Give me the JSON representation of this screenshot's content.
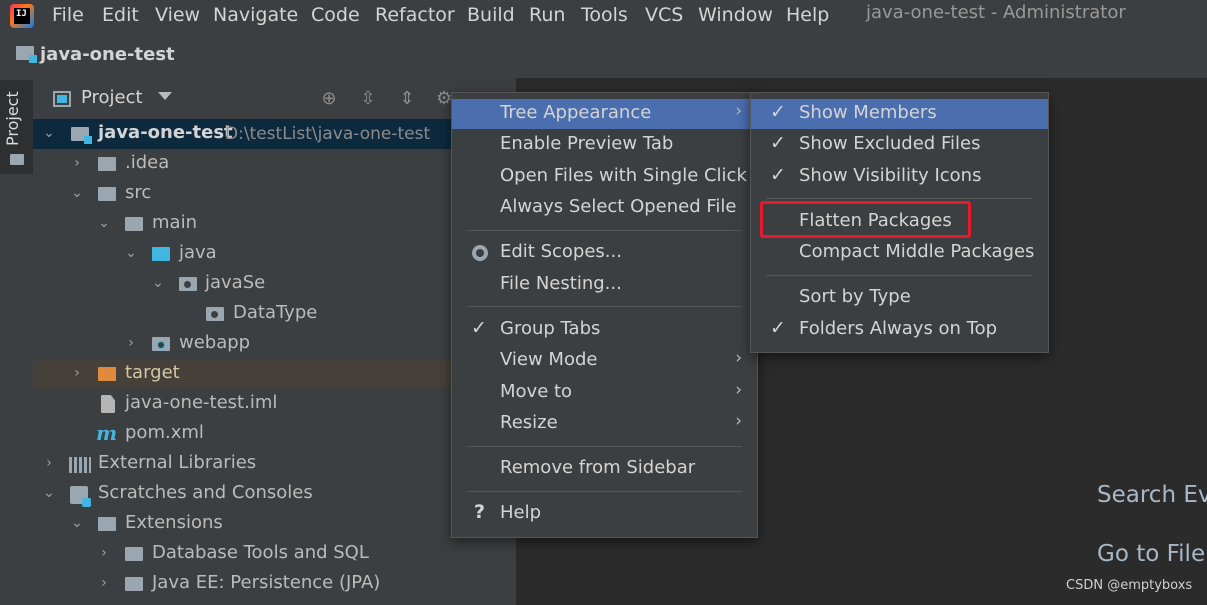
{
  "menubar": {
    "items": [
      "File",
      "Edit",
      "View",
      "Navigate",
      "Code",
      "Refactor",
      "Build",
      "Run",
      "Tools",
      "VCS",
      "Window",
      "Help"
    ],
    "window_title": "java-one-test - Administrator"
  },
  "navbar": {
    "project": "java-one-test"
  },
  "tool_strip": {
    "project_tab": "Project"
  },
  "panel": {
    "title": "Project"
  },
  "tree": {
    "root": {
      "name": "java-one-test",
      "path": "D:\\testList\\java-one-test"
    },
    "idea": ".idea",
    "src": "src",
    "main": "main",
    "java": "java",
    "javase": "javaSe",
    "datatype": "DataType",
    "webapp": "webapp",
    "target": "target",
    "iml": "java-one-test.iml",
    "pom": "pom.xml",
    "external": "External Libraries",
    "scratches": "Scratches and Consoles",
    "extensions": "Extensions",
    "dbtools": "Database Tools and SQL",
    "javaee": "Java EE: Persistence (JPA)"
  },
  "context_menu": {
    "tree_appearance": "Tree Appearance",
    "enable_preview": "Enable Preview Tab",
    "open_single_click": "Open Files with Single Click",
    "always_select": "Always Select Opened File",
    "edit_scopes": "Edit Scopes...",
    "file_nesting": "File Nesting...",
    "group_tabs": "Group Tabs",
    "view_mode": "View Mode",
    "move_to": "Move to",
    "resize": "Resize",
    "remove_sidebar": "Remove from Sidebar",
    "help": "Help"
  },
  "submenu": {
    "show_members": "Show Members",
    "show_excluded": "Show Excluded Files",
    "show_visibility": "Show Visibility Icons",
    "flatten": "Flatten Packages",
    "compact_middle": "Compact Middle Packages",
    "sort_type": "Sort by Type",
    "folders_top": "Folders Always on Top"
  },
  "editor": {
    "hint_search": "Search Ev",
    "hint_goto": "Go to File"
  },
  "watermark": "CSDN @emptyboxs",
  "glyphs": {
    "check": "✓",
    "submenu_arrow": "›",
    "expanded": "⌄",
    "collapsed": "›",
    "help_mark": "?"
  },
  "colors": {
    "menu_highlight": "#4b6eaf",
    "annotation_box": "#e8192c",
    "selected_row": "#0d293e"
  }
}
